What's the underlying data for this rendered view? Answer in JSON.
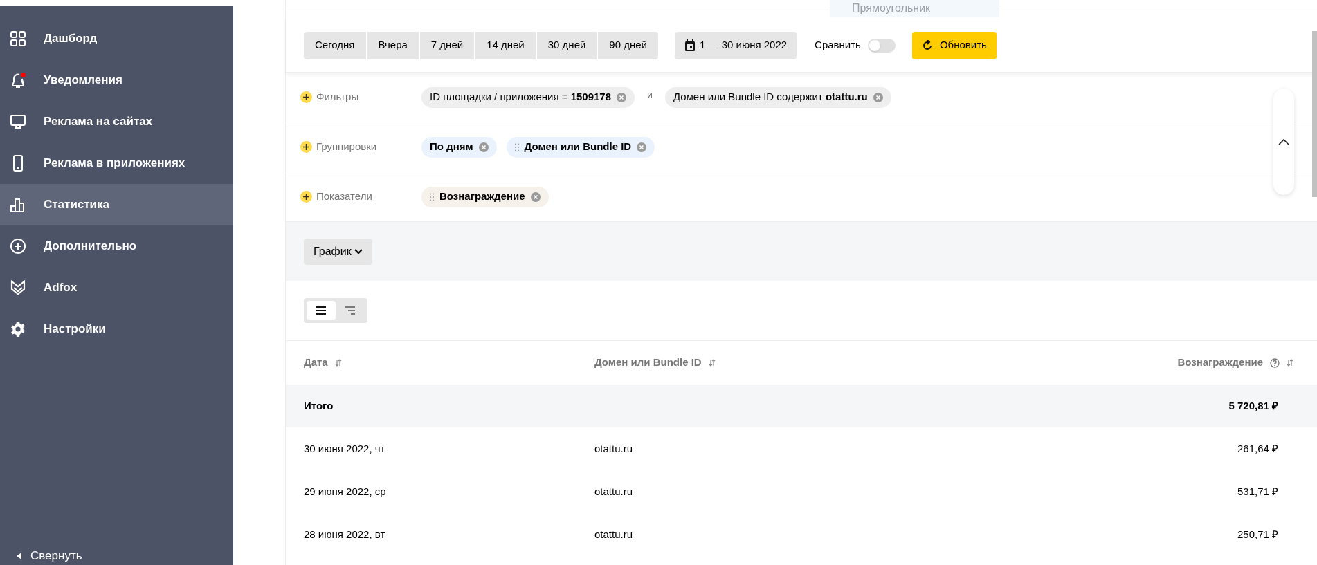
{
  "sidebar": {
    "items": [
      {
        "label": "Дашборд",
        "selected": false,
        "alert": false
      },
      {
        "label": "Уведомления",
        "selected": false,
        "alert": true
      },
      {
        "label": "Реклама на сайтах",
        "selected": false,
        "alert": false
      },
      {
        "label": "Реклама в приложениях",
        "selected": false,
        "alert": false
      },
      {
        "label": "Статистика",
        "selected": true,
        "alert": false
      },
      {
        "label": "Дополнительно",
        "selected": false,
        "alert": false
      },
      {
        "label": "Adfox",
        "selected": false,
        "alert": false
      },
      {
        "label": "Настройки",
        "selected": false,
        "alert": false
      }
    ],
    "collapse": "Свернуть"
  },
  "tooltip": "Прямоугольник",
  "periods": [
    "Сегодня",
    "Вчера",
    "7 дней",
    "14 дней",
    "30 дней",
    "90 дней"
  ],
  "date_range": "1 — 30 июня 2022",
  "compare": {
    "label": "Сравнить",
    "on": false
  },
  "refresh": "Обновить",
  "filters": {
    "label": "Фильтры",
    "chips": [
      "ID площадки / приложения = **1509178**",
      "Домен или Bundle ID содержит **otattu.ru**"
    ],
    "joiner": "и"
  },
  "groupings": {
    "label": "Группировки",
    "chips": [
      {
        "text": "По дням",
        "draggable": false
      },
      {
        "text": "Домен или Bundle ID",
        "draggable": true
      }
    ]
  },
  "metrics": {
    "label": "Показатели",
    "chips": [
      {
        "text": "Вознаграждение",
        "draggable": true
      }
    ]
  },
  "chart_button": "График",
  "view_toggle": [
    {
      "selected": true
    },
    {
      "selected": false
    }
  ],
  "table": {
    "columns": [
      "Дата",
      "Домен или Bundle ID",
      "Вознаграждение"
    ],
    "total": {
      "label": "Итого",
      "value": "5 720,81 ₽"
    },
    "rows": [
      [
        "30 июня 2022, чт",
        "otattu.ru",
        "261,64 ₽"
      ],
      [
        "29 июня 2022, ср",
        "otattu.ru",
        "531,71 ₽"
      ],
      [
        "28 июня 2022, вт",
        "otattu.ru",
        "250,71 ₽"
      ]
    ]
  }
}
